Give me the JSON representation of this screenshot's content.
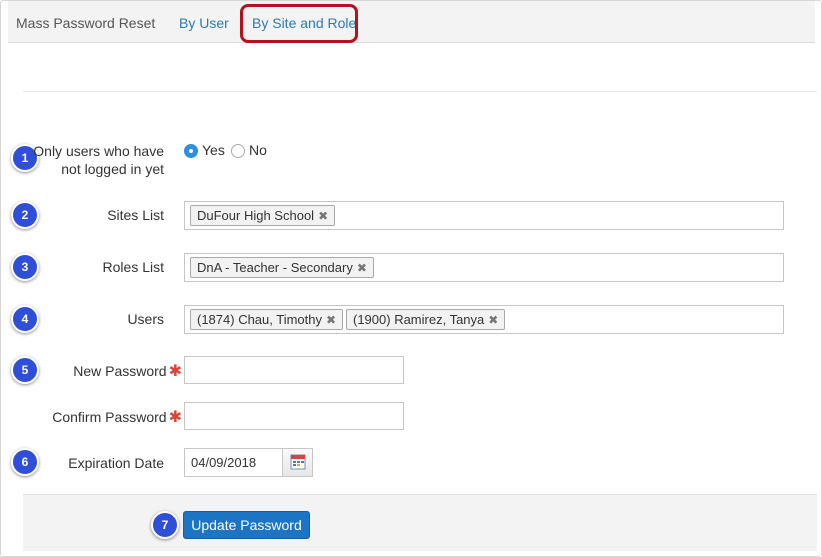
{
  "tabs": {
    "title": "Mass Password Reset",
    "by_user": "By User",
    "by_site_role": "By Site and Role"
  },
  "steps": [
    "1",
    "2",
    "3",
    "4",
    "5",
    "6",
    "7"
  ],
  "form": {
    "not_logged_in": {
      "label_line1": "Only users who have",
      "label_line2": "not logged in yet",
      "options": [
        "Yes",
        "No"
      ],
      "selected": "Yes"
    },
    "sites": {
      "label": "Sites List",
      "chips": [
        "DuFour High School"
      ]
    },
    "roles": {
      "label": "Roles List",
      "chips": [
        "DnA - Teacher - Secondary"
      ]
    },
    "users": {
      "label": "Users",
      "chips": [
        "(1874) Chau, Timothy",
        "(1900) Ramirez, Tanya"
      ]
    },
    "new_password": {
      "label": "New Password",
      "value": ""
    },
    "confirm_password": {
      "label": "Confirm Password",
      "value": ""
    },
    "expiration": {
      "label": "Expiration Date",
      "value": "04/09/2018"
    },
    "remove_glyph": "✖",
    "required_glyph": "✱"
  },
  "actions": {
    "submit_label": "Update Password"
  },
  "colors": {
    "badge": "#2f4fd9",
    "link": "#2a7ab8",
    "primary": "#1b74c4",
    "highlight": "#b3121f",
    "required": "#d9453a"
  },
  "icons": {
    "calendar": "calendar-icon"
  }
}
